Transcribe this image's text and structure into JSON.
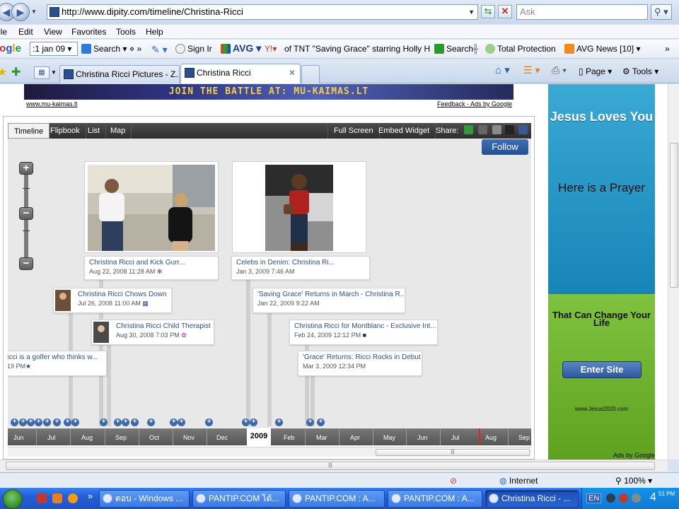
{
  "browser": {
    "url": "http://www.dipity.com/timeline/Christina-Ricci",
    "search_placeholder": "Ask",
    "menu": [
      "ile",
      "Edit",
      "View",
      "Favorites",
      "Tools",
      "Help"
    ],
    "toolbar": {
      "google_logo": [
        "oo",
        "g",
        "l",
        "e"
      ],
      "date_value": ":1 jan 09",
      "search_label": "Search",
      "sign_in": "Sign Ir",
      "avg_label": "AVG",
      "avg_search_value": "of TNT \"Saving Grace\" starring Holly Hunte",
      "search_btn": "Search",
      "total_protection": "Total Protection",
      "avg_news": "AVG News [10]"
    },
    "tabs": [
      {
        "label": "Christina Ricci Pictures - Z..."
      },
      {
        "label": "Christina Ricci",
        "active": true
      }
    ],
    "commands": {
      "page": "Page",
      "tools": "Tools"
    }
  },
  "ad": {
    "banner_text": "JOIN THE BATTLE AT: MU-KAIMAS.LT",
    "url": "www.mu-kaimas.lt",
    "feedback": "Feedback - Ads by Google"
  },
  "widget": {
    "tabs": [
      "Timeline",
      "Flipbook",
      "List",
      "Map",
      "Full Screen",
      "Embed Widget",
      "Share:"
    ],
    "share_colors": [
      "#2f9c3a",
      "#666666",
      "#8a8a8a",
      "#222222",
      "#3b5998"
    ],
    "follow": "Follow",
    "events": [
      {
        "title": "Christina Ricci and Kick Gurr...",
        "date": "Aug 22, 2008 11:28 AM"
      },
      {
        "title": "Celebs in Denim: Christina Ri...",
        "date": "Jan 3, 2009 7:46 AM"
      },
      {
        "title": "Christina Ricci Chows Down",
        "date": "Jul 26, 2008 11:00 AM"
      },
      {
        "title": "'Saving Grace' Returns in March - Christina R...",
        "date": "Jan 22, 2009 9:22 AM"
      },
      {
        "title": "Christina Ricci Child Therapist",
        "date": "Aug 30, 2008 7:03 PM"
      },
      {
        "title": "Christina Ricci for Montblanc - Exclusive Int...",
        "date": "Feb 24, 2009 12:12 PM"
      },
      {
        "title": "icci is a golfer who thinks w...",
        "date": "19 PM"
      },
      {
        "title": "'Grace' Returns: Ricci Rocks in Debut",
        "date": "Mar 3, 2009 12:34 PM"
      }
    ],
    "axis": {
      "months": [
        "Jun",
        "Jul",
        "Aug",
        "Sep",
        "Oct",
        "Nov",
        "Dec",
        "Feb",
        "Mar",
        "Apr",
        "May",
        "Jun",
        "Jul",
        "Aug",
        "Sep"
      ],
      "year": "2009"
    }
  },
  "side_ad": {
    "headline": "Jesus Loves You",
    "prayer": "Here is a Prayer",
    "change": "That Can Change Your Life",
    "button": "Enter Site",
    "url": "www.Jesus2020.com",
    "ads_by": "Ads by Google"
  },
  "status": {
    "zone": "Internet",
    "zoom": "100%"
  },
  "taskbar": {
    "tasks": [
      "ตอบ - Windows ...",
      "PANTIP.COM ได้...",
      "PANTIP.COM : A...",
      "PANTIP.COM : A...",
      "Christina Ricci - ..."
    ],
    "lang": "EN",
    "clock": "4",
    "clock_small": "51 PM"
  }
}
